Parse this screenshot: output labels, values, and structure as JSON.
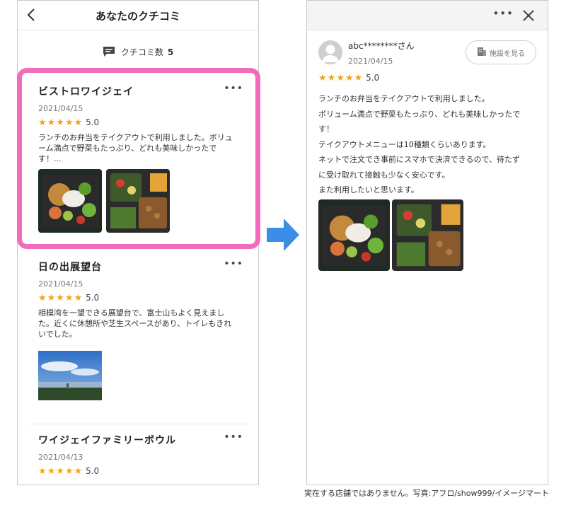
{
  "left": {
    "header": {
      "back_icon": "chevron-left-icon",
      "title": "あなたのクチコミ"
    },
    "count": {
      "label": "クチコミ数",
      "value": "5"
    },
    "reviews": [
      {
        "name": "ビストロワイジェイ",
        "date": "2021/04/15",
        "stars": "★★★★★",
        "rating": "5.0",
        "text": "ランチのお弁当をテイクアウトで利用しました。ボリューム満点で野菜もたっぷり、どれも美味しかったです！..."
      },
      {
        "name": "日の出展望台",
        "date": "2021/04/15",
        "stars": "★★★★★",
        "rating": "5.0",
        "text": "相模湾を一望できる展望台で、富士山もよく見えました。近くに休憩所や芝生スペースがあり、トイレもきれいでした。"
      },
      {
        "name": "ワイジェイファミリーボウル",
        "date": "2021/04/13",
        "stars": "★★★★★",
        "rating": "5.0",
        "text": ""
      }
    ],
    "more_label": "•••"
  },
  "right": {
    "header": {
      "more_label": "•••",
      "close_icon": "close-icon"
    },
    "user": "abc********さん",
    "date": "2021/04/15",
    "facility_button": "施設を見る",
    "stars": "★★★★★",
    "rating": "5.0",
    "text_lines": [
      "ランチのお弁当をテイクアウトで利用しました。",
      "ボリューム満点で野菜もたっぷり、どれも美味しかったで",
      "す！",
      "テイクアウトメニューは10種類くらいあります。",
      "ネットで注文でき事前にスマホで決済できるので、待たず",
      "に受け取れて接触も少なく安心です。",
      "また利用したいと思います。"
    ]
  },
  "caption": "実在する店舗ではありません。写真:アフロ/show999/イメージマート",
  "colors": {
    "highlight": "#f26cbb",
    "arrow": "#3c8de8",
    "star": "#f2a516"
  }
}
